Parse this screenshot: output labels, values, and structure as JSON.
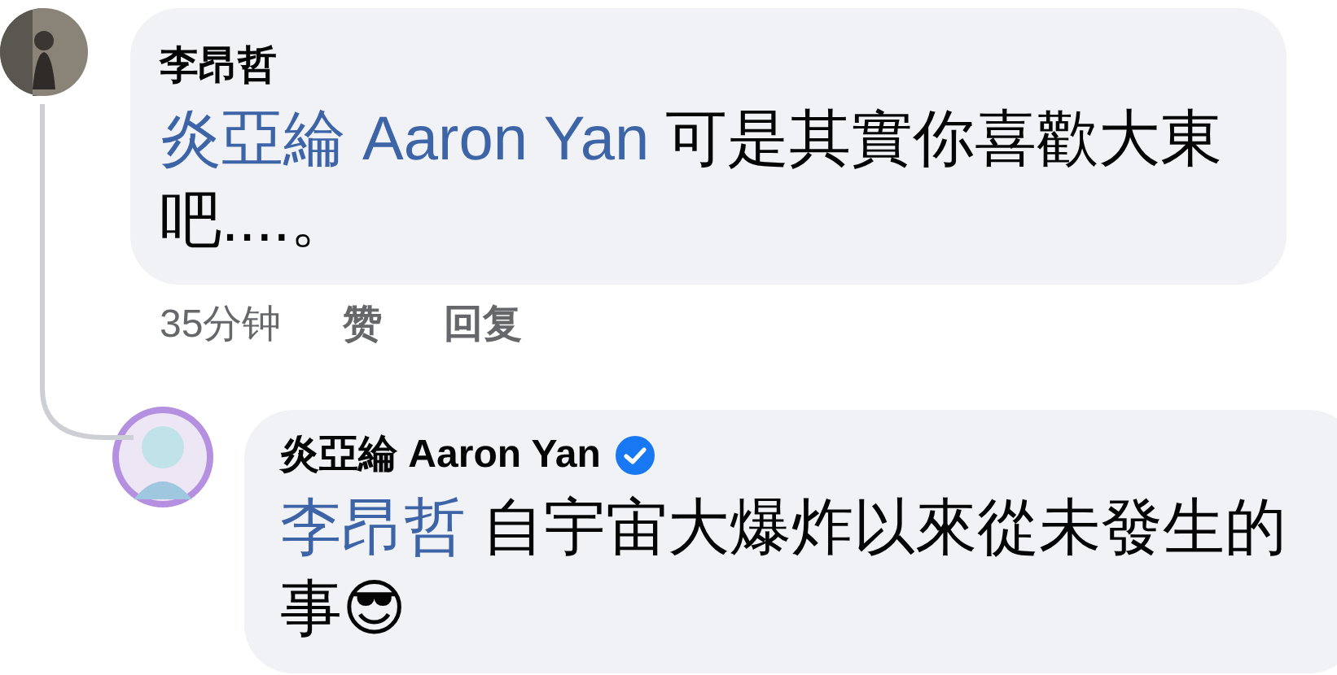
{
  "comment": {
    "author": "李昂哲",
    "mention": "炎亞綸 Aaron Yan",
    "text": "可是其實你喜歡大東吧....。",
    "time": "35分钟",
    "actions": [
      "赞",
      "回复"
    ]
  },
  "reply": {
    "author": "炎亞綸 Aaron Yan",
    "verified": true,
    "mention": "李昂哲",
    "text": "自宇宙大爆炸以來從未發生的事😎"
  }
}
